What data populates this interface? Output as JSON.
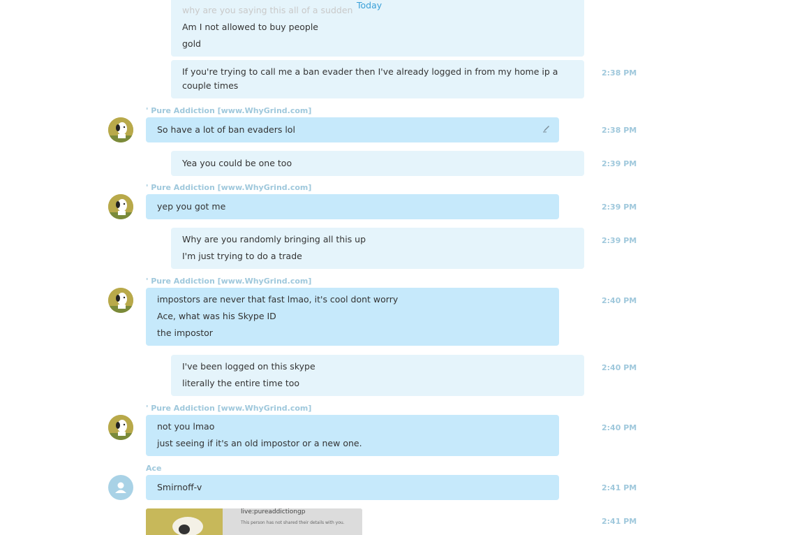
{
  "header": {
    "date_divider": "Today"
  },
  "sender_names": {
    "pure": "' Pure Addiction [www.WhyGrind.com]",
    "ace": "Ace"
  },
  "messages": [
    {
      "lines": [
        "why are you saying this all of a sudden",
        "Am I not allowed to buy people",
        "gold"
      ],
      "time": ""
    },
    {
      "lines": [
        "If you're trying to call me a ban evader then I've already logged in from my home ip a",
        "couple times"
      ],
      "time": "2:38 PM"
    },
    {
      "lines": [
        "So have a lot of ban evaders lol"
      ],
      "time": "2:38 PM"
    },
    {
      "lines": [
        "Yea you could be one too"
      ],
      "time": "2:39 PM"
    },
    {
      "lines": [
        "yep you got me"
      ],
      "time": "2:39 PM"
    },
    {
      "lines": [
        "Why are you randomly bringing all this up",
        "I'm just trying to do a trade"
      ],
      "time": "2:39 PM"
    },
    {
      "lines": [
        "impostors are never that fast lmao, it's cool dont worry",
        "Ace, what was his Skype ID",
        "the impostor"
      ],
      "time": "2:40 PM"
    },
    {
      "lines": [
        "I've been logged on this skype",
        "literally the entire time too"
      ],
      "time": "2:40 PM"
    },
    {
      "lines": [
        "not you lmao",
        "just seeing if it's an old impostor or a new one."
      ],
      "time": "2:40 PM"
    },
    {
      "lines": [
        "Smirnoff-v"
      ],
      "time": "2:41 PM"
    },
    {
      "attachment": {
        "title": "live:pureaddictiongp",
        "subtitle": "This person has not shared their details with you."
      },
      "time": "2:41 PM"
    }
  ],
  "colors": {
    "outgoing_bubble": "#e5f4fb",
    "incoming_bubble": "#c6e9fb",
    "timestamp": "#9fc8dc",
    "accent": "#3aa0d8"
  },
  "icons": [
    "edit-icon",
    "default-avatar-icon",
    "snoopy-avatar"
  ]
}
